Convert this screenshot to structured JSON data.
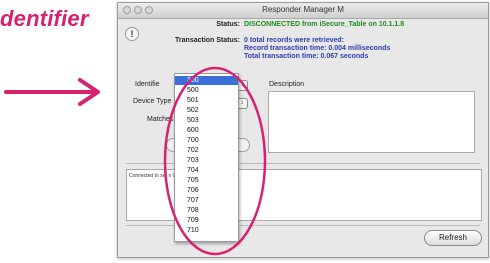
{
  "annotation": {
    "label": "dentifier"
  },
  "window": {
    "title": "Responder Manager M"
  },
  "status": {
    "label": "Status:",
    "value": "DISCONNECTED from iSecure_Table on 10.1.1.8",
    "transaction_label": "Transaction Status:",
    "transaction_lines": [
      "0 total records were retrieved:",
      "Record transaction time: 0.004 milliseconds",
      "Total transaction time: 0.067 seconds"
    ]
  },
  "form": {
    "identifier_label": "Identifie",
    "device_type_label": "Device Type",
    "matches_label": "Matches",
    "description_label": "Description"
  },
  "log": {
    "text": "Connected to ser                                   n 0 ticks"
  },
  "dropdown": {
    "selected": "300",
    "options": [
      "300",
      "500",
      "501",
      "502",
      "503",
      "600",
      "700",
      "702",
      "703",
      "704",
      "705",
      "706",
      "707",
      "708",
      "709",
      "710"
    ]
  },
  "buttons": {
    "refresh": "Refresh"
  },
  "colors": {
    "annotation": "#d6226f",
    "status_ok": "#1f8a1f",
    "info": "#2e3db0",
    "selection": "#3a6fd8"
  }
}
